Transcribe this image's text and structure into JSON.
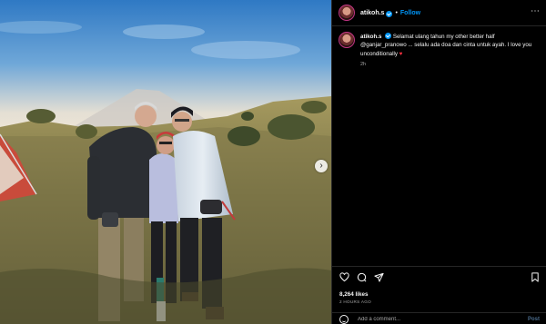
{
  "photo": {
    "alt_subject": "mountain-photo",
    "carousel_next_icon": "chevron-right-icon"
  },
  "header": {
    "username": "atikoh.s",
    "separator": "•",
    "follow_label": "Follow",
    "more_icon": "more-horizontal-icon"
  },
  "caption": {
    "username": "atikoh.s",
    "text": "Selamat ulang tahun my other better half @ganjar_pranowo ... selalu ada doa dan cinta untuk ayah. I love you unconditionally",
    "heart": "♥",
    "time": "2h"
  },
  "actions": {
    "icons": [
      "heart-icon",
      "comment-icon",
      "share-icon",
      "bookmark-icon"
    ],
    "likes": "8,264 likes",
    "time_ago": "2 HOURS AGO"
  },
  "comment": {
    "placeholder": "Add a comment...",
    "post_label": "Post"
  },
  "colors": {
    "accent": "#0095f6",
    "background": "#000000",
    "like_red": "#ff3040"
  }
}
